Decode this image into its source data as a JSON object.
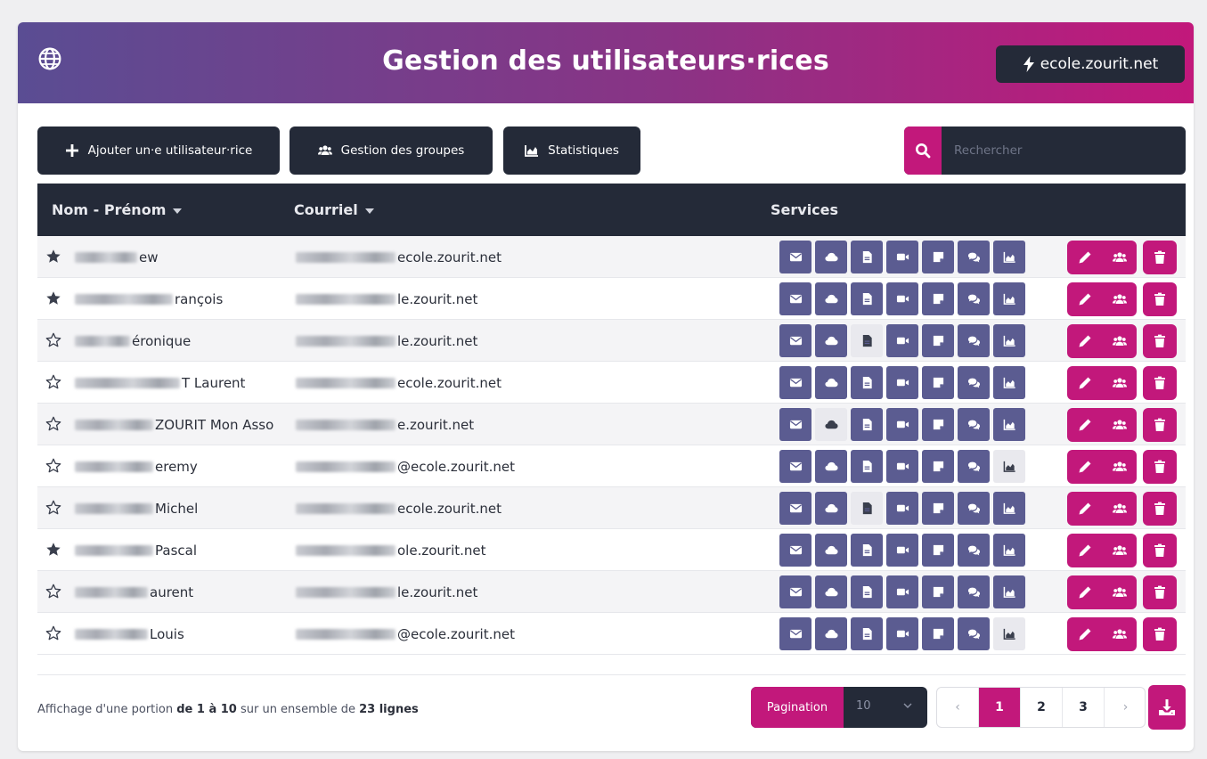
{
  "header": {
    "title": "Gestion des utilisateurs·rices",
    "domain": "ecole.zourit.net",
    "gradient": [
      "#5a4d93",
      "#c2187b"
    ]
  },
  "toolbar": {
    "add_label": "Ajouter un·e utilisateur·rice",
    "groups_label": "Gestion des groupes",
    "stats_label": "Statistiques"
  },
  "search": {
    "placeholder": "Rechercher",
    "value": ""
  },
  "table": {
    "columns": {
      "name": "Nom - Prénom",
      "email": "Courriel",
      "services": "Services"
    },
    "service_icons": [
      "mail-icon",
      "cloud-icon",
      "document-icon",
      "video-icon",
      "note-icon",
      "chat-icon",
      "chart-icon"
    ],
    "rows": [
      {
        "starred": true,
        "name_visible": "ew",
        "email_visible": "ecole.zourit.net",
        "services_off": []
      },
      {
        "starred": true,
        "name_visible": "rançois",
        "email_visible": "le.zourit.net",
        "services_off": []
      },
      {
        "starred": false,
        "name_visible": "éronique",
        "email_visible": "le.zourit.net",
        "services_off": [
          2
        ]
      },
      {
        "starred": false,
        "name_visible": "T Laurent",
        "email_visible": "ecole.zourit.net",
        "services_off": []
      },
      {
        "starred": false,
        "name_visible": "ZOURIT Mon Asso",
        "email_visible": "e.zourit.net",
        "services_off": [
          1
        ]
      },
      {
        "starred": false,
        "name_visible": "eremy",
        "email_visible": "@ecole.zourit.net",
        "services_off": [
          6
        ]
      },
      {
        "starred": false,
        "name_visible": "Michel",
        "email_visible": "ecole.zourit.net",
        "services_off": [
          2
        ]
      },
      {
        "starred": true,
        "name_visible": "Pascal",
        "email_visible": "ole.zourit.net",
        "services_off": []
      },
      {
        "starred": false,
        "name_visible": "aurent",
        "email_visible": "le.zourit.net",
        "services_off": []
      },
      {
        "starred": false,
        "name_visible": "Louis",
        "email_visible": "@ecole.zourit.net",
        "services_off": [
          6
        ]
      }
    ]
  },
  "footer": {
    "summary_prefix": "Affichage d'une portion ",
    "summary_range": "de 1 à 10",
    "summary_middle": " sur un ensemble de ",
    "summary_total": "23 lignes",
    "pagination_label": "Pagination",
    "pagination_value": "10",
    "pages": [
      "1",
      "2",
      "3"
    ],
    "prev": "‹",
    "next": "›",
    "active_page": "1"
  },
  "colors": {
    "accent": "#c2187b",
    "dark": "#242a38",
    "service": "#5b5c91",
    "service_off": "#e9e9ee"
  }
}
